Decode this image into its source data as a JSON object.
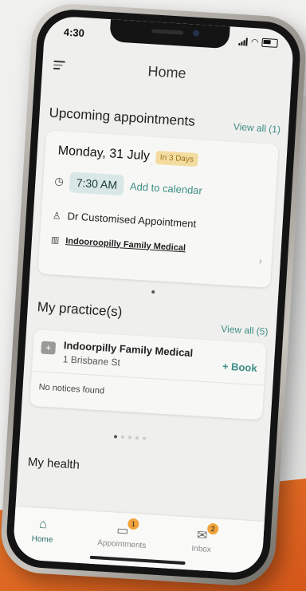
{
  "status": {
    "time": "4:30"
  },
  "header": {
    "title": "Home"
  },
  "upcoming": {
    "heading": "Upcoming appointments",
    "view_all": "View all (1)",
    "date": "Monday, 31 July",
    "relative": "In 3 Days",
    "time": "7:30 AM",
    "add_calendar": "Add to calendar",
    "doctor": "Dr Customised Appointment",
    "location": "Indooroopilly Family Medical"
  },
  "practices": {
    "heading": "My practice(s)",
    "view_all": "View all (5)",
    "name": "Indoorpilly Family Medical",
    "address": "1 Brisbane St",
    "book": "+ Book",
    "notices": "No notices found"
  },
  "health": {
    "heading": "My health"
  },
  "tabs": [
    {
      "label": "Home"
    },
    {
      "label": "Appointments",
      "badge": "1"
    },
    {
      "label": "Inbox",
      "badge": "2"
    }
  ],
  "colors": {
    "accent": "#3e8f87",
    "badge": "#f1a33a",
    "chip": "#f4dca0"
  }
}
